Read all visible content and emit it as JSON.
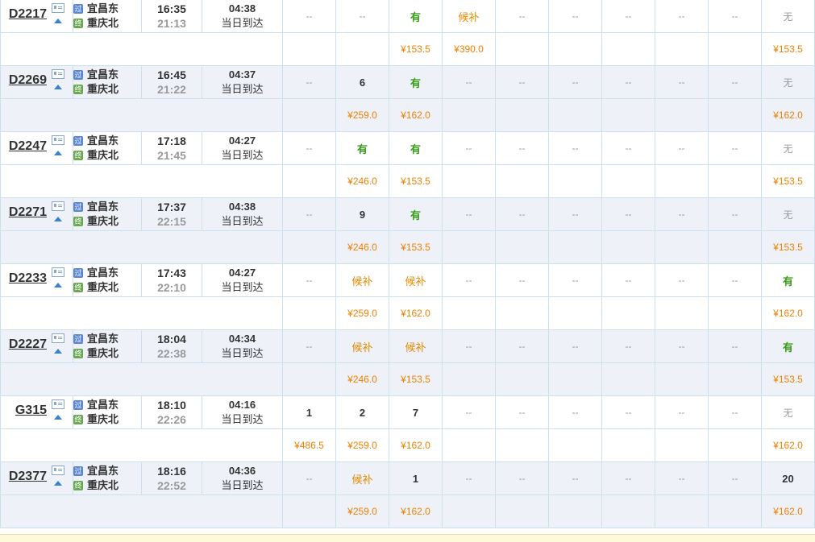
{
  "badges": {
    "pass": "过",
    "end": "终"
  },
  "trains": [
    {
      "no": "D2217",
      "from": "宜昌东",
      "to": "重庆北",
      "dep": "16:35",
      "arr": "21:13",
      "dur": "04:38",
      "note": "当日到达",
      "seats": [
        "--",
        "--",
        "有",
        "候补",
        "--",
        "--",
        "--",
        "--",
        "--",
        "无"
      ],
      "prices": [
        "",
        "",
        "¥153.5",
        "¥390.0",
        "",
        "",
        "",
        "",
        "",
        "¥153.5"
      ]
    },
    {
      "no": "D2269",
      "from": "宜昌东",
      "to": "重庆北",
      "dep": "16:45",
      "arr": "21:22",
      "dur": "04:37",
      "note": "当日到达",
      "seats": [
        "--",
        "6",
        "有",
        "--",
        "--",
        "--",
        "--",
        "--",
        "--",
        "无"
      ],
      "prices": [
        "",
        "¥259.0",
        "¥162.0",
        "",
        "",
        "",
        "",
        "",
        "",
        "¥162.0"
      ]
    },
    {
      "no": "D2247",
      "from": "宜昌东",
      "to": "重庆北",
      "dep": "17:18",
      "arr": "21:45",
      "dur": "04:27",
      "note": "当日到达",
      "seats": [
        "--",
        "有",
        "有",
        "--",
        "--",
        "--",
        "--",
        "--",
        "--",
        "无"
      ],
      "prices": [
        "",
        "¥246.0",
        "¥153.5",
        "",
        "",
        "",
        "",
        "",
        "",
        "¥153.5"
      ]
    },
    {
      "no": "D2271",
      "from": "宜昌东",
      "to": "重庆北",
      "dep": "17:37",
      "arr": "22:15",
      "dur": "04:38",
      "note": "当日到达",
      "seats": [
        "--",
        "9",
        "有",
        "--",
        "--",
        "--",
        "--",
        "--",
        "--",
        "无"
      ],
      "prices": [
        "",
        "¥246.0",
        "¥153.5",
        "",
        "",
        "",
        "",
        "",
        "",
        "¥153.5"
      ]
    },
    {
      "no": "D2233",
      "from": "宜昌东",
      "to": "重庆北",
      "dep": "17:43",
      "arr": "22:10",
      "dur": "04:27",
      "note": "当日到达",
      "seats": [
        "--",
        "候补",
        "候补",
        "--",
        "--",
        "--",
        "--",
        "--",
        "--",
        "有"
      ],
      "prices": [
        "",
        "¥259.0",
        "¥162.0",
        "",
        "",
        "",
        "",
        "",
        "",
        "¥162.0"
      ]
    },
    {
      "no": "D2227",
      "from": "宜昌东",
      "to": "重庆北",
      "dep": "18:04",
      "arr": "22:38",
      "dur": "04:34",
      "note": "当日到达",
      "seats": [
        "--",
        "候补",
        "候补",
        "--",
        "--",
        "--",
        "--",
        "--",
        "--",
        "有"
      ],
      "prices": [
        "",
        "¥246.0",
        "¥153.5",
        "",
        "",
        "",
        "",
        "",
        "",
        "¥153.5"
      ]
    },
    {
      "no": "G315",
      "from": "宜昌东",
      "to": "重庆北",
      "dep": "18:10",
      "arr": "22:26",
      "dur": "04:16",
      "note": "当日到达",
      "seats": [
        "1",
        "2",
        "7",
        "--",
        "--",
        "--",
        "--",
        "--",
        "--",
        "无"
      ],
      "prices": [
        "¥486.5",
        "¥259.0",
        "¥162.0",
        "",
        "",
        "",
        "",
        "",
        "",
        "¥162.0"
      ]
    },
    {
      "no": "D2377",
      "from": "宜昌东",
      "to": "重庆北",
      "dep": "18:16",
      "arr": "22:52",
      "dur": "04:36",
      "note": "当日到达",
      "seats": [
        "--",
        "候补",
        "1",
        "--",
        "--",
        "--",
        "--",
        "--",
        "--",
        "20"
      ],
      "prices": [
        "",
        "¥259.0",
        "¥162.0",
        "",
        "",
        "",
        "",
        "",
        "",
        "¥162.0"
      ]
    }
  ]
}
